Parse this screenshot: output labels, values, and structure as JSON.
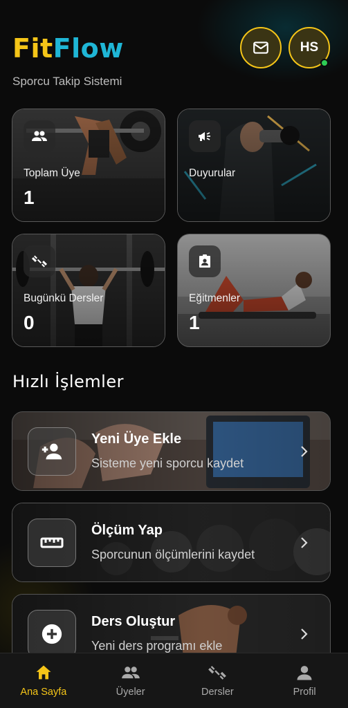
{
  "brand": {
    "name_part1": "Fit",
    "name_part2": "Flow",
    "subtitle": "Sporcu Takip Sistemi"
  },
  "header": {
    "avatar_initials": "HS"
  },
  "stats": [
    {
      "label": "Toplam Üye",
      "value": "1",
      "icon": "group-icon"
    },
    {
      "label": "Duyurular",
      "value": "",
      "icon": "megaphone-icon"
    },
    {
      "label": "Bugünkü Dersler",
      "value": "0",
      "icon": "dumbbell-icon"
    },
    {
      "label": "Eğitmenler",
      "value": "1",
      "icon": "badge-icon"
    }
  ],
  "quick_actions": {
    "title": "Hızlı İşlemler",
    "items": [
      {
        "title": "Yeni Üye Ekle",
        "desc": "Sisteme yeni sporcu kaydet",
        "icon": "person-add-icon"
      },
      {
        "title": "Ölçüm Yap",
        "desc": "Sporcunun ölçümlerini kaydet",
        "icon": "ruler-icon"
      },
      {
        "title": "Ders Oluştur",
        "desc": "Yeni ders programı ekle",
        "icon": "add-circle-icon"
      }
    ]
  },
  "nav": [
    {
      "label": "Ana Sayfa",
      "icon": "home-icon",
      "active": true
    },
    {
      "label": "Üyeler",
      "icon": "group-icon",
      "active": false
    },
    {
      "label": "Dersler",
      "icon": "dumbbell-icon",
      "active": false
    },
    {
      "label": "Profil",
      "icon": "person-icon",
      "active": false
    }
  ],
  "colors": {
    "accent": "#f5c518",
    "brand_secondary": "#1fb6d6",
    "online": "#2ecc55"
  }
}
